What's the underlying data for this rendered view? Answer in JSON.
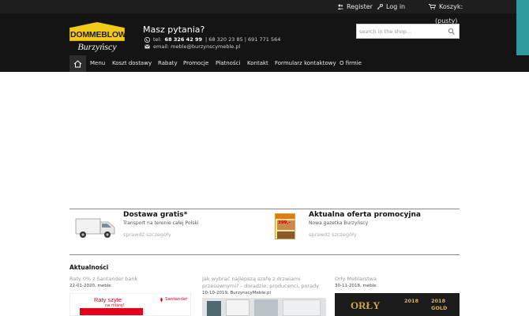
{
  "topbar": {
    "register_label": "Register",
    "login_label": "Log in",
    "cart_label": "Koszyk:",
    "cart_status": "(pusty)"
  },
  "logo": {
    "brand_top": "DOMMEBLOWY",
    "brand_bottom": "Burzyńscy"
  },
  "header": {
    "question": "Masz pytania?",
    "tel_prefix": "tel:",
    "tel_main": "68 326 42 99",
    "tel_rest": "| 68 320 23 85 | 691 771 564",
    "email_label": "email: meble@burzynscymeble.pl"
  },
  "search": {
    "placeholder": "search in the shop..."
  },
  "nav": {
    "items": [
      "Menu",
      "Koszt dostawy",
      "Rabaty",
      "Promocje",
      "Płatności",
      "Kontakt",
      "Formularz kontaktowy",
      "O firmie"
    ]
  },
  "promos": [
    {
      "title": "Dostawa gratis*",
      "subtitle": "Transport na terenie całej Polski",
      "link": "sprawdź szczegóły"
    },
    {
      "title": "Aktualna oferta promocyjna",
      "subtitle": "Nowa gazetka Burzyńscy",
      "link": "sprawdź szczegóły",
      "badge": "399,-"
    }
  ],
  "news": {
    "heading": "Aktualności",
    "items": [
      {
        "title": "Raty 0% z Santander bank",
        "date": "22-01-2020, meble",
        "image_text": "Raty szyte",
        "image_text2": "na miarę!",
        "image_brand": "Santander"
      },
      {
        "title": "Jak wybrać najlepszą szafę z drzwiami przesuwnymi? - doradzie, producenci, porady",
        "date": "10-10-2019, BurzynscyMeble.pl"
      },
      {
        "title": "Orły Meblarstwa",
        "date": "30-11-2018, meble",
        "image_text": "ORŁY",
        "image_badge": "2018",
        "image_badge2": "2018",
        "image_badge3": "GOLD"
      }
    ]
  },
  "colors": {
    "header_bg": "#141414",
    "accent_teal": "#2e9a9c",
    "logo_yellow": "#f3c91a",
    "santander_red": "#e2001a"
  }
}
